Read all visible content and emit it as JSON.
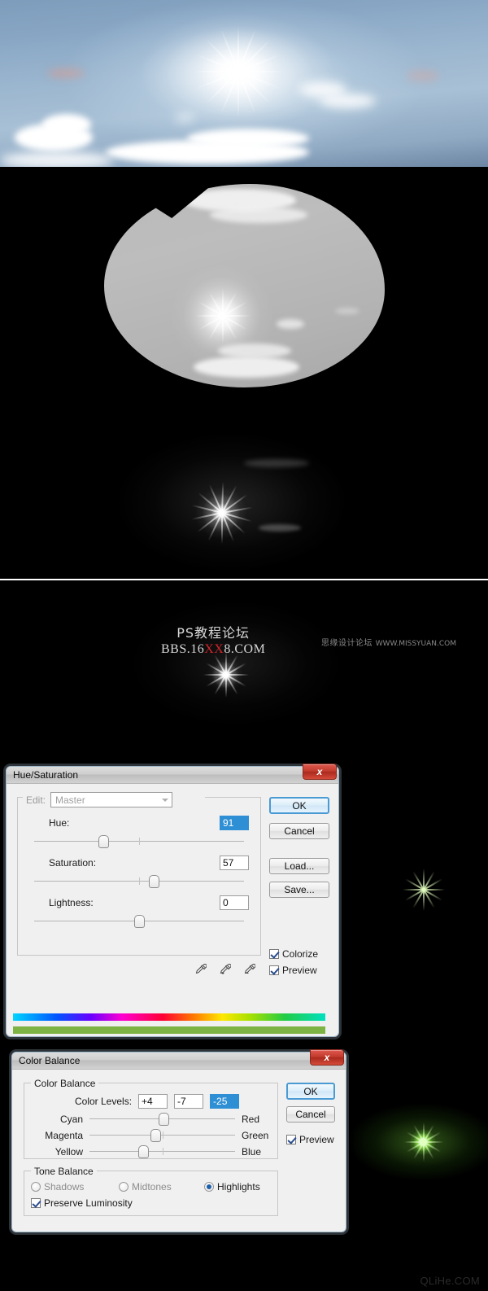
{
  "panels": {
    "sky": {
      "name": "sky-photo-with-sun"
    },
    "grey": {
      "name": "desaturated-elliptical-selection"
    },
    "dark": {
      "name": "dark-sun-glow"
    },
    "watermark_panel": {
      "name": "dark-sun-glow-with-watermark"
    }
  },
  "watermark": {
    "line1": "PS教程论坛",
    "line2_pre": "BBS.16",
    "line2_xx": "XX",
    "line2_post": "8.COM",
    "right_cn": "思缘设计论坛",
    "right_url": "WWW.MISSYUAN.COM"
  },
  "footer": {
    "credit": "QLiHe.COM"
  },
  "hue_saturation": {
    "title": "Hue/Saturation",
    "close_label": "x",
    "edit_label": "Edit:",
    "edit_value": "Master",
    "hue_label": "Hue:",
    "hue_value": "91",
    "saturation_label": "Saturation:",
    "saturation_value": "57",
    "lightness_label": "Lightness:",
    "lightness_value": "0",
    "buttons": {
      "ok": "OK",
      "cancel": "Cancel",
      "load": "Load...",
      "save": "Save..."
    },
    "colorize_label": "Colorize",
    "colorize_checked": true,
    "preview_label": "Preview",
    "preview_checked": true,
    "slider_positions": {
      "hue": 33,
      "saturation": 57,
      "lightness": 50
    },
    "colors": {
      "spectrum_result": "#7cb342",
      "selection_blue": "#2e8fd4",
      "titlebar_close": "#c0392b"
    }
  },
  "color_balance": {
    "title": "Color Balance",
    "close_label": "x",
    "group_label": "Color Balance",
    "color_levels_label": "Color Levels:",
    "levels": [
      "+4",
      "-7",
      "-25"
    ],
    "selected_level_index": 2,
    "sliders": [
      {
        "left": "Cyan",
        "right": "Red",
        "pos": 51
      },
      {
        "left": "Magenta",
        "right": "Green",
        "pos": 45
      },
      {
        "left": "Yellow",
        "right": "Blue",
        "pos": 37
      }
    ],
    "tone_balance_label": "Tone Balance",
    "tone_options": [
      {
        "label": "Shadows",
        "selected": false
      },
      {
        "label": "Midtones",
        "selected": false
      },
      {
        "label": "Highlights",
        "selected": true
      }
    ],
    "preserve_luminosity_label": "Preserve Luminosity",
    "preserve_luminosity_checked": true,
    "buttons": {
      "ok": "OK",
      "cancel": "Cancel"
    },
    "preview_label": "Preview",
    "preview_checked": true
  }
}
